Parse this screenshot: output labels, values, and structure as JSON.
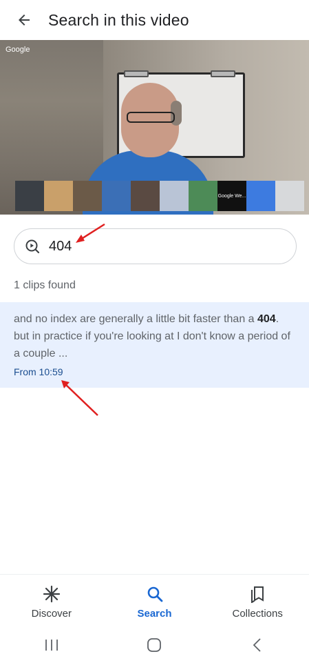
{
  "header": {
    "title": "Search in this video",
    "back_icon": "arrow-back-icon"
  },
  "video": {
    "watermark": "Google",
    "thumbnails": [
      {
        "label": ""
      },
      {
        "label": ""
      },
      {
        "label": ""
      },
      {
        "label": ""
      },
      {
        "label": ""
      },
      {
        "label": ""
      },
      {
        "label": ""
      },
      {
        "label": "Google We..."
      },
      {
        "label": ""
      },
      {
        "label": ""
      }
    ]
  },
  "search": {
    "icon": "play-search-icon",
    "value": "404"
  },
  "results": {
    "count_text": "1 clips found",
    "clips": [
      {
        "text_before": "and no index are generally a little bit faster than a ",
        "highlight": "404",
        "text_after": ". but in practice if you're looking at I don't know a period of a couple ...",
        "timestamp": "From 10:59"
      }
    ]
  },
  "bottom_nav": {
    "items": [
      {
        "label": "Discover",
        "icon": "asterisk-icon",
        "active": false
      },
      {
        "label": "Search",
        "icon": "search-icon",
        "active": true
      },
      {
        "label": "Collections",
        "icon": "bookmarks-icon",
        "active": false
      }
    ]
  },
  "system_nav": {
    "recents_icon": "recents-icon",
    "home_icon": "home-icon",
    "back_icon": "system-back-icon"
  },
  "colors": {
    "accent": "#1967d2",
    "clip_background": "#e8f0fe",
    "annotation_arrow": "#e02020"
  }
}
